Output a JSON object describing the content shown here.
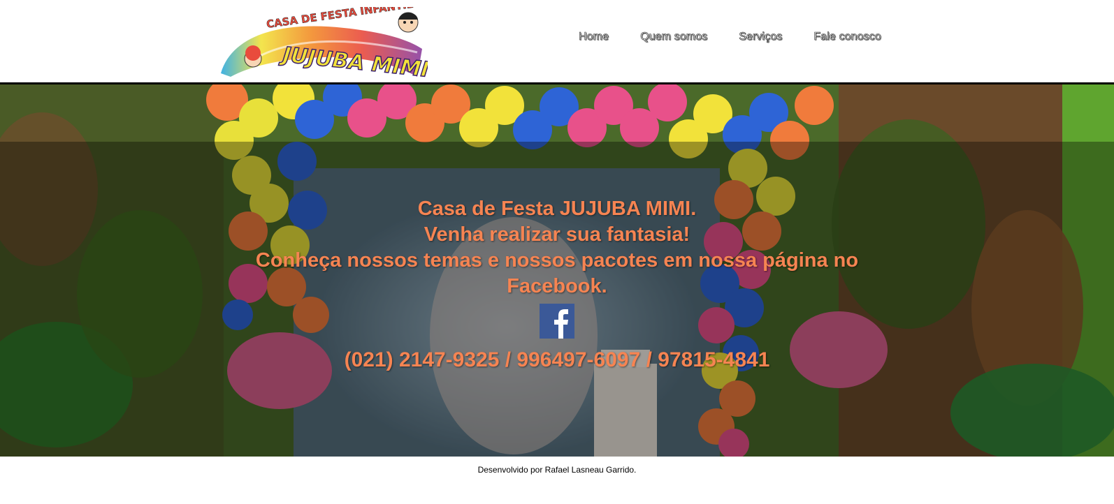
{
  "header": {
    "logo": {
      "top_text": "CASA DE FESTA INFANTIL",
      "main_text": "JUJUBA MIMI"
    },
    "nav": [
      {
        "label": "Home"
      },
      {
        "label": "Quem somos"
      },
      {
        "label": "Serviços"
      },
      {
        "label": "Fale conosco"
      }
    ]
  },
  "hero": {
    "line1": "Casa de Festa JUJUBA MIMI.",
    "line2": "Venha realizar sua fantasia!",
    "line3": "Conheça nossos temas e nossos pacotes em nossa página no Facebook.",
    "facebook_icon": "facebook-icon",
    "phones": "(021) 2147-9325 / 996497-6097 / 97815-4841",
    "text_color": "#f68452"
  },
  "footer": {
    "credit": "Desenvolvido por Rafael Lasneau Garrido."
  }
}
